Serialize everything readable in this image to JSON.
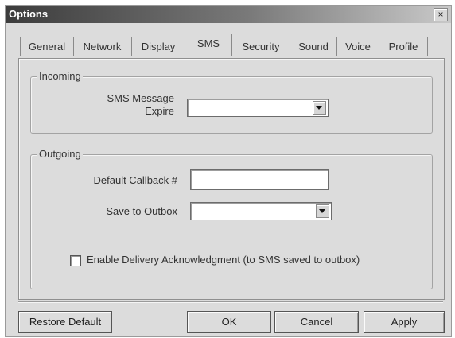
{
  "window": {
    "title": "Options",
    "close_glyph": "×"
  },
  "tabs": [
    {
      "label": "General"
    },
    {
      "label": "Network"
    },
    {
      "label": "Display"
    },
    {
      "label": "SMS"
    },
    {
      "label": "Security"
    },
    {
      "label": "Sound"
    },
    {
      "label": "Voice"
    },
    {
      "label": "Profile"
    }
  ],
  "active_tab": "SMS",
  "incoming": {
    "legend": "Incoming",
    "expire_label_line1": "SMS Message",
    "expire_label_line2": "Expire",
    "expire_value": ""
  },
  "outgoing": {
    "legend": "Outgoing",
    "callback_label": "Default Callback #",
    "callback_value": "",
    "outbox_label": "Save to Outbox",
    "outbox_value": "",
    "ack_label": "Enable Delivery Acknowledgment (to SMS saved to outbox)",
    "ack_checked": false
  },
  "buttons": {
    "restore": "Restore Default",
    "ok": "OK",
    "cancel": "Cancel",
    "apply": "Apply"
  },
  "icons": {
    "dropdown": "chevron-down-icon",
    "close": "close-icon"
  }
}
